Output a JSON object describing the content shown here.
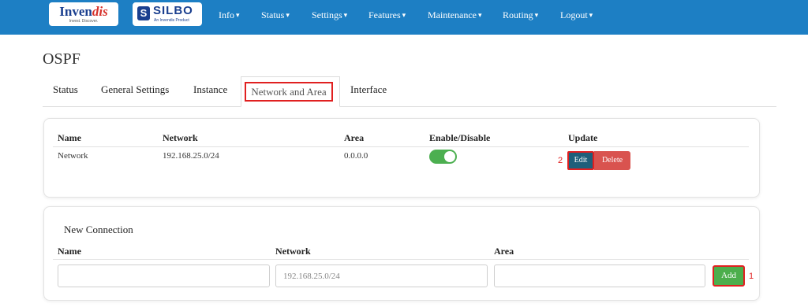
{
  "header": {
    "logo_primary": {
      "name_part1": "Inven",
      "name_part2": "dis",
      "tagline": "Invest. Discover."
    },
    "logo_secondary": {
      "mark": "S",
      "name": "SILBO",
      "tagline": "An Invendis Product"
    },
    "nav": [
      {
        "label": "Info"
      },
      {
        "label": "Status"
      },
      {
        "label": "Settings"
      },
      {
        "label": "Features"
      },
      {
        "label": "Maintenance"
      },
      {
        "label": "Routing"
      },
      {
        "label": "Logout"
      }
    ],
    "caret": "▾"
  },
  "page": {
    "title": "OSPF"
  },
  "tabs": [
    {
      "label": "Status"
    },
    {
      "label": "General Settings"
    },
    {
      "label": "Instance"
    },
    {
      "label": "Network and Area",
      "active": true
    },
    {
      "label": "Interface"
    }
  ],
  "network_table": {
    "columns": [
      "Name",
      "Network",
      "Area",
      "Enable/Disable",
      "Update"
    ],
    "rows": [
      {
        "name": "Network",
        "network": "192.168.25.0/24",
        "area": "0.0.0.0",
        "enabled": true,
        "edit_label": "Edit",
        "delete_label": "Delete"
      }
    ]
  },
  "new_connection": {
    "title": "New Connection",
    "columns": [
      "Name",
      "Network",
      "Area"
    ],
    "name_value": "",
    "network_placeholder": "192.168.25.0/24",
    "area_value": "",
    "add_label": "Add"
  },
  "annotations": {
    "add_marker": "1",
    "edit_marker": "2"
  },
  "colors": {
    "topbar": "#1d7fc4",
    "highlight": "#e02020",
    "toggle_on": "#4caf50",
    "edit": "#1f5f7a",
    "delete": "#d9534f",
    "add": "#4cae4c"
  }
}
